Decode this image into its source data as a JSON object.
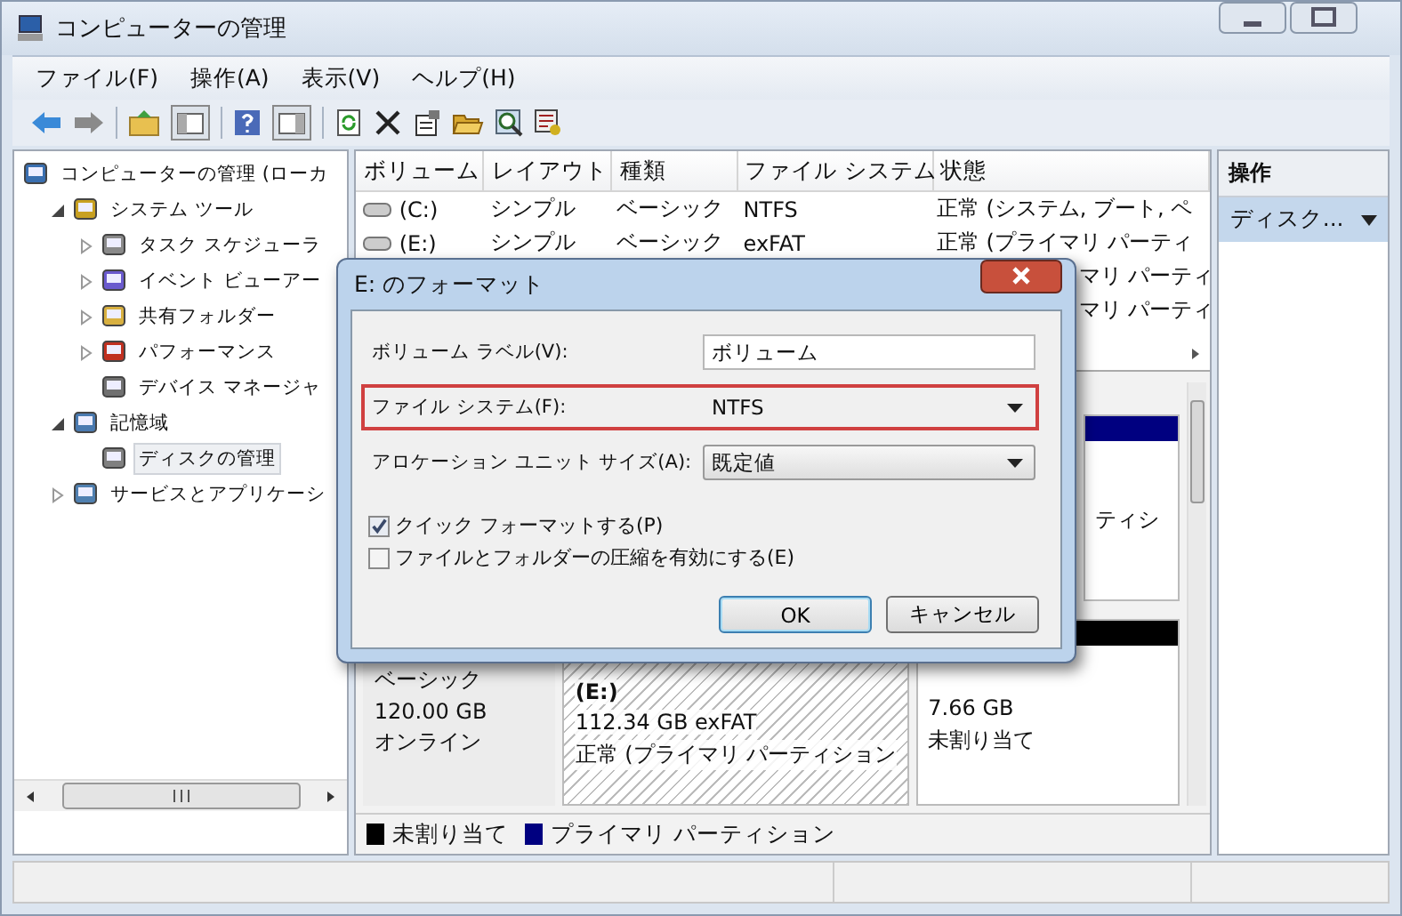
{
  "window": {
    "title": "コンピューターの管理"
  },
  "menu": [
    "ファイル(F)",
    "操作(A)",
    "表示(V)",
    "ヘルプ(H)"
  ],
  "tree": [
    {
      "label": "コンピューターの管理 (ローカ",
      "selected": false,
      "children": [
        {
          "label": "システム ツール",
          "selected": false,
          "expanded": true,
          "children": [
            {
              "label": "タスク スケジューラ",
              "selected": false,
              "expanded": false
            },
            {
              "label": "イベント ビューアー",
              "selected": false,
              "expanded": false
            },
            {
              "label": "共有フォルダー",
              "selected": false,
              "expanded": false
            },
            {
              "label": "パフォーマンス",
              "selected": false,
              "expanded": false
            },
            {
              "label": "デバイス マネージャ",
              "selected": false
            }
          ]
        },
        {
          "label": "記憶域",
          "selected": false,
          "expanded": true,
          "children": [
            {
              "label": "ディスクの管理",
              "selected": true
            }
          ]
        },
        {
          "label": "サービスとアプリケーシ",
          "selected": false,
          "expanded": false
        }
      ]
    }
  ],
  "table": {
    "columns": [
      "ボリューム",
      "レイアウト",
      "種類",
      "ファイル システム",
      "状態"
    ],
    "rows": [
      {
        "volume": "(C:)",
        "layout": "シンプル",
        "type": "ベーシック",
        "file_system": "NTFS",
        "status": "正常 (システム, ブート, ペ"
      },
      {
        "volume": "(E:)",
        "layout": "シンプル",
        "type": "ベーシック",
        "file_system": "exFAT",
        "status": "正常 (プライマリ パーティ"
      },
      {
        "status": "マリ パーティ"
      },
      {
        "status": "マリ パーティ"
      }
    ]
  },
  "disks": [
    {
      "partitions": [
        {
          "color": "#000080",
          "lines": [
            "ティシ"
          ],
          "hatched": false
        }
      ]
    },
    {
      "info": [
        "ベーシック",
        "120.00 GB",
        "オンライン"
      ],
      "partitions": [
        {
          "lines": [
            "(E:)",
            "112.34 GB exFAT",
            "正常 (プライマリ パーティション"
          ],
          "hatched": true
        },
        {
          "color": "#000000",
          "lines": [
            "7.66 GB",
            "未割り当て"
          ],
          "hatched": false
        }
      ]
    }
  ],
  "legend": [
    {
      "label": "未割り当て",
      "color": "#000000"
    },
    {
      "label": "プライマリ パーティション",
      "color": "#000080"
    }
  ],
  "actions": {
    "title": "操作",
    "item": "ディスク..."
  },
  "dialog": {
    "title": "E: のフォーマット",
    "fields": [
      {
        "kind": "text",
        "label": "ボリューム ラベル(V):",
        "value": "ボリューム",
        "highlighted": false
      },
      {
        "kind": "select",
        "label": "ファイル システム(F):",
        "value": "NTFS",
        "highlighted": true
      },
      {
        "kind": "select",
        "label": "アロケーション ユニット サイズ(A):",
        "value": "既定値",
        "highlighted": false
      }
    ],
    "options": [
      {
        "label": "クイック フォーマットする(P)",
        "checked": true
      },
      {
        "label": "ファイルとフォルダーの圧縮を有効にする(E)",
        "checked": false
      }
    ],
    "buttons": [
      {
        "label": "OK",
        "default": true
      },
      {
        "label": "キャンセル",
        "default": false
      }
    ]
  }
}
